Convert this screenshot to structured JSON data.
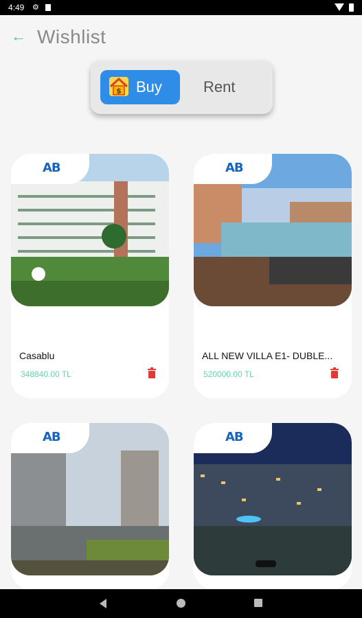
{
  "status_bar": {
    "time": "4:49"
  },
  "header": {
    "title": "Wishlist"
  },
  "toggle": {
    "buy_label": "Buy",
    "rent_label": "Rent",
    "selected": "Buy"
  },
  "logo_text": "AB",
  "listings": [
    {
      "name": "Casablu",
      "price": "348840.00 TL"
    },
    {
      "name": "ALL NEW VILLA E1- DUBLE...",
      "price": "520000.00 TL"
    },
    {
      "name": "",
      "price": ""
    },
    {
      "name": "",
      "price": ""
    }
  ],
  "colors": {
    "accent": "#3fc6a4",
    "buy_active": "#2f8de8",
    "price": "#5fd3b3",
    "delete": "#e53935",
    "logo": "#1565c0"
  }
}
